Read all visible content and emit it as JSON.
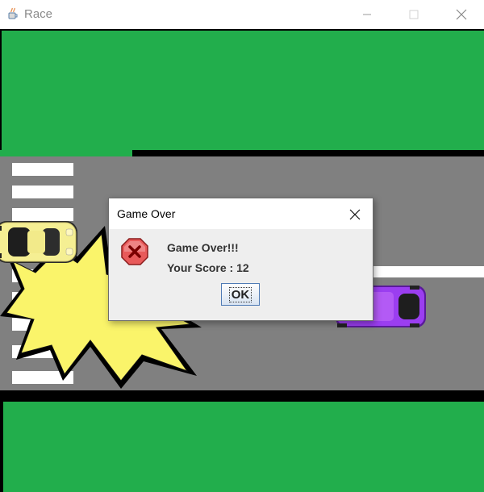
{
  "window": {
    "title": "Race",
    "icon": "java-cup-icon"
  },
  "game": {
    "scene": "road-crash",
    "cars": [
      {
        "name": "player-car",
        "color": "#f5ef93"
      },
      {
        "name": "opponent-car",
        "color": "#8a2be2"
      }
    ],
    "explosion_color": "#faf46a",
    "grass_color": "#22ae4c",
    "road_color": "#808080"
  },
  "dialog": {
    "title": "Game Over",
    "icon": "error-x-icon",
    "message": "Game Over!!!",
    "score_text": "Your Score : 12",
    "ok_label": "OK"
  }
}
